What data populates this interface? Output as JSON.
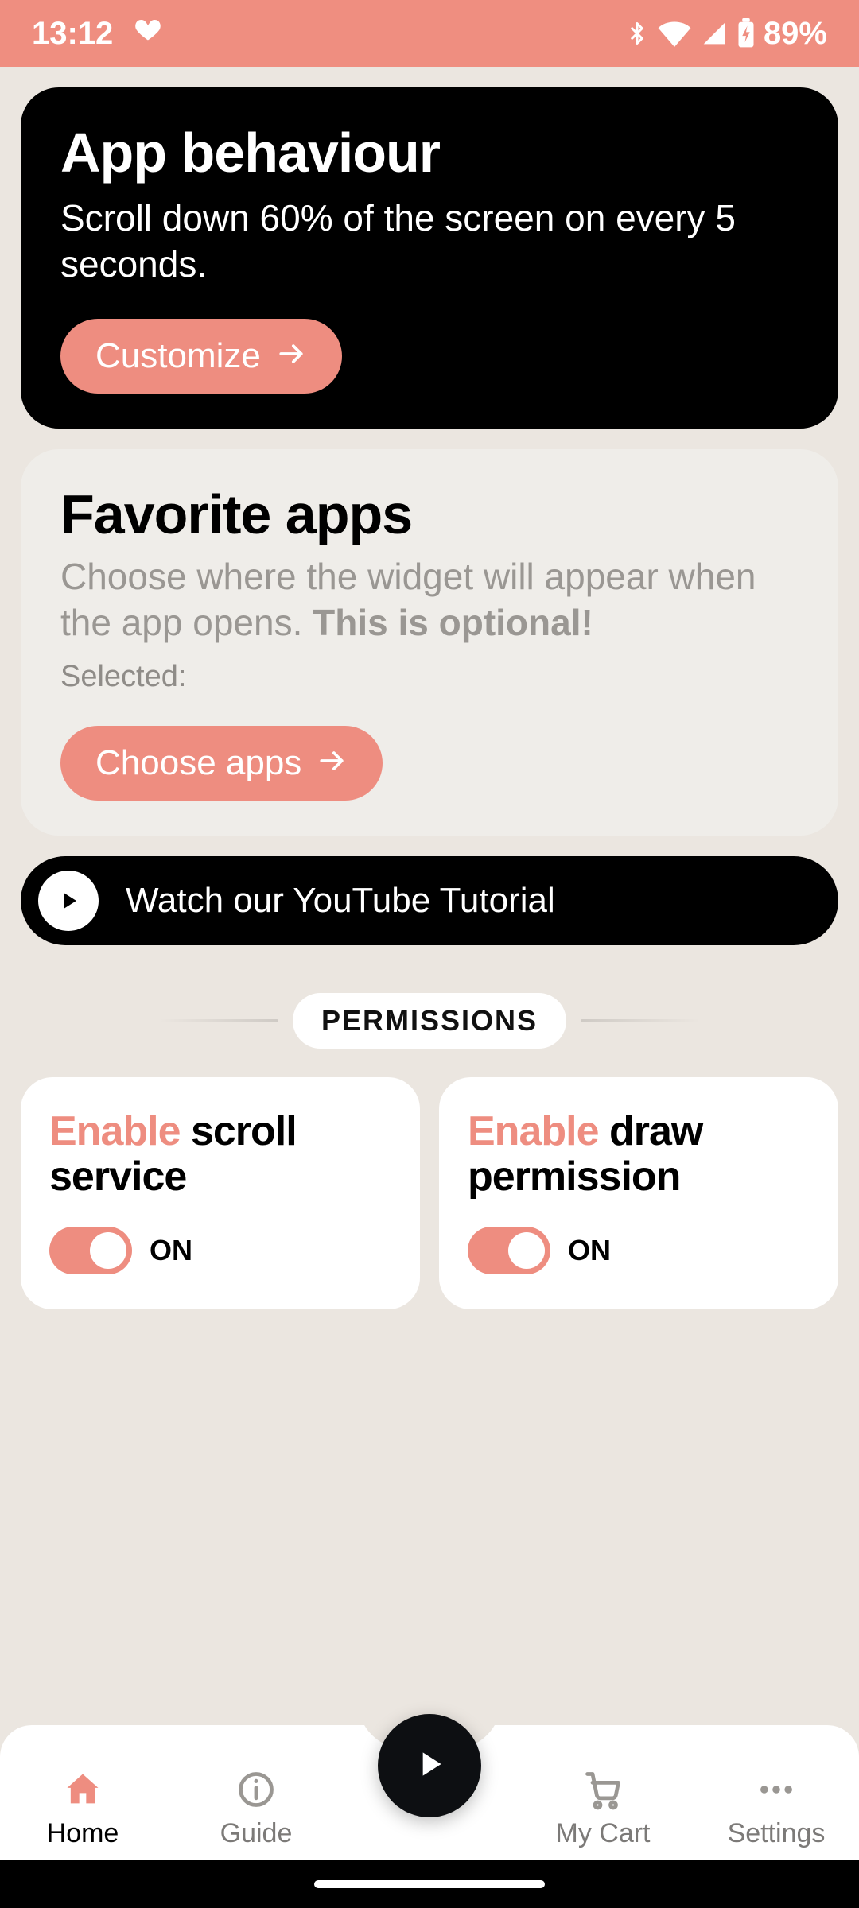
{
  "status": {
    "time": "13:12",
    "battery_text": "89%"
  },
  "behaviour": {
    "title": "App behaviour",
    "desc": "Scroll down 60% of the screen on every 5 seconds.",
    "button": "Customize"
  },
  "favorites": {
    "title": "Favorite apps",
    "desc_plain": "Choose where the widget will appear when the app opens. ",
    "desc_bold": "This is optional!",
    "selected_label": "Selected:",
    "button": "Choose apps"
  },
  "tutorial": {
    "label": "Watch our YouTube Tutorial"
  },
  "permissions": {
    "section_label": "PERMISSIONS",
    "cards": [
      {
        "accent": "Enable",
        "rest": " scroll service",
        "state": "ON",
        "on": true
      },
      {
        "accent": "Enable",
        "rest": " draw permission",
        "state": "ON",
        "on": true
      }
    ]
  },
  "nav": {
    "items": [
      {
        "label": "Home"
      },
      {
        "label": "Guide"
      },
      {
        "label": "My Cart"
      },
      {
        "label": "Settings"
      }
    ]
  },
  "colors": {
    "accent": "#ee8d80",
    "statusbar": "#ef8e80",
    "bg": "#ebe6e0"
  }
}
